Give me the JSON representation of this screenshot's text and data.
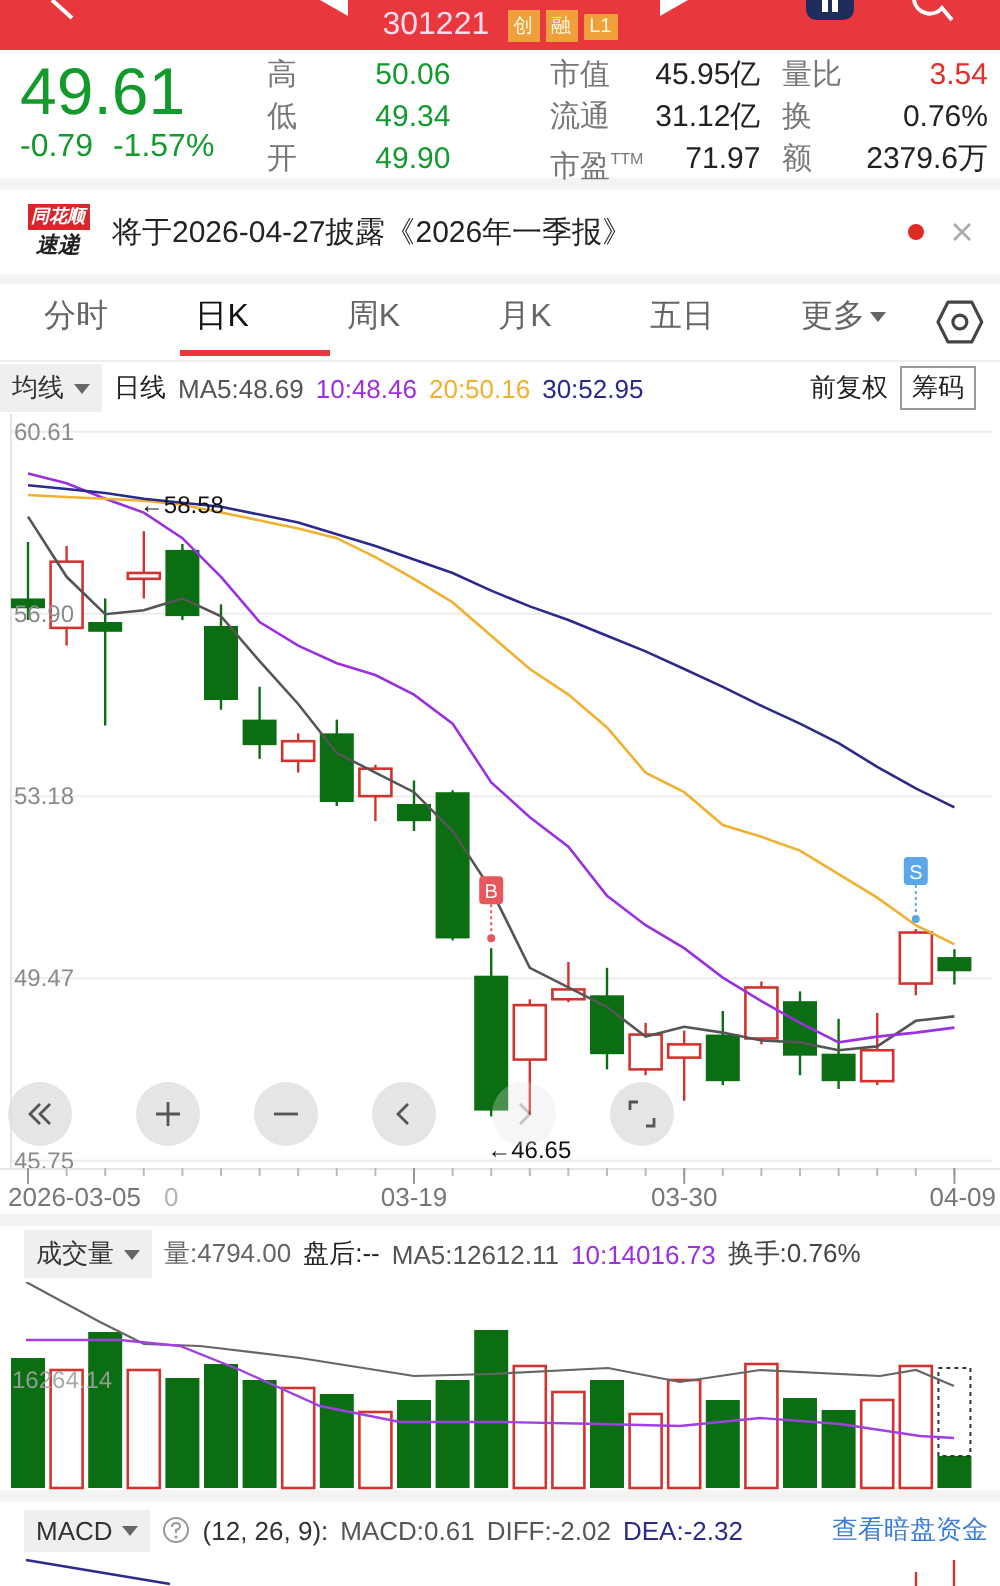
{
  "header": {
    "code": "301221",
    "badges": [
      "创",
      "融",
      "L1"
    ]
  },
  "quote": {
    "price": "49.61",
    "change": "-0.79",
    "change_pct": "-1.57%",
    "color": "#139a2c",
    "stat_columns": [
      [
        {
          "label": "高",
          "value": "50.06",
          "color": "#139a2c"
        },
        {
          "label": "低",
          "value": "49.34",
          "color": "#139a2c"
        },
        {
          "label": "开",
          "value": "49.90",
          "color": "#139a2c"
        }
      ],
      [
        {
          "label": "市值",
          "value": "45.95亿",
          "color": "#222222"
        },
        {
          "label": "流通",
          "value": "31.12亿",
          "color": "#222222"
        },
        {
          "label": "市盈$^{TTM}$",
          "value": "71.97",
          "color": "#222222"
        }
      ],
      [
        {
          "label": "量比",
          "value": "3.54",
          "color": "#e0302b"
        },
        {
          "label": "换",
          "value": "0.76%",
          "color": "#222222"
        },
        {
          "label": "额",
          "value": "2379.6万",
          "color": "#222222"
        }
      ]
    ]
  },
  "news": {
    "logo_top": "同花顺",
    "logo_bottom": "速递",
    "text": "将于2026-04-27披露《2026年一季报》",
    "unread": true
  },
  "kline": {
    "tabs": [
      {
        "label": "分时",
        "selected": false,
        "kind": "plain"
      },
      {
        "label": "日K",
        "selected": true,
        "kind": "plain"
      },
      {
        "label": "周K",
        "selected": false,
        "kind": "plain"
      },
      {
        "label": "月K",
        "selected": false,
        "kind": "plain"
      },
      {
        "label": "五日",
        "selected": false,
        "kind": "plain"
      },
      {
        "label": "更多",
        "selected": false,
        "kind": "dropdown"
      }
    ],
    "indicator": "均线",
    "period": "日线",
    "legend": [
      {
        "text": "MA5:48.69",
        "color": "#555555"
      },
      {
        "text": "10:48.46",
        "color": "#9b30e0"
      },
      {
        "text": "20:50.16",
        "color": "#f0b030"
      },
      {
        "text": "30:52.95",
        "color": "#2a2a8a"
      }
    ],
    "adjust": "前复权",
    "chips_button": "筹码",
    "candles": [
      {
        "rising": false
      },
      {
        "rising": true
      },
      {
        "rising": false
      },
      {
        "rising": true
      },
      {
        "rising": false
      },
      {
        "rising": false
      },
      {
        "rising": false
      },
      {
        "rising": true
      },
      {
        "rising": false
      },
      {
        "rising": true
      },
      {
        "rising": false
      },
      {
        "rising": false
      },
      {
        "rising": false
      },
      {
        "rising": true
      },
      {
        "rising": true
      },
      {
        "rising": false
      },
      {
        "rising": true
      },
      {
        "rising": true
      },
      {
        "rising": false
      },
      {
        "rising": true
      },
      {
        "rising": false
      },
      {
        "rising": false
      },
      {
        "rising": true
      },
      {
        "rising": true
      },
      {
        "rising": false
      }
    ],
    "extreme_labels": [
      "←58.58",
      "←46.65"
    ],
    "signals": [
      {
        "kind": "buy",
        "label": "B"
      },
      {
        "kind": "sell",
        "label": "S"
      }
    ],
    "date_labels": [
      "2026-03-05",
      "03-19",
      "03-30",
      "04-09"
    ],
    "xaxis_fragment": "0",
    "controls": [
      {
        "kind": "rewind",
        "disabled": false
      },
      {
        "kind": "zoom_in",
        "disabled": false
      },
      {
        "kind": "zoom_out",
        "disabled": false
      },
      {
        "kind": "prev",
        "disabled": false
      },
      {
        "kind": "next",
        "disabled": true
      },
      {
        "kind": "fullscreen",
        "disabled": false
      }
    ],
    "chart_data": {
      "type": "line",
      "grid": true,
      "ylim": [
        45.6,
        60.97
      ],
      "yticks": [
        {
          "value": 60.61,
          "label": "60.61"
        },
        {
          "value": 56.9,
          "label": "56.90"
        },
        {
          "value": 53.18,
          "label": "53.18"
        },
        {
          "value": 49.47,
          "label": "49.47"
        },
        {
          "value": 45.75,
          "label": "45.75"
        }
      ],
      "series": [
        {
          "color": "#555555",
          "values": [
            58.88,
            57.65,
            56.89,
            56.97,
            57.21,
            56.85,
            55.93,
            55.06,
            54.06,
            53.66,
            53.26,
            52.47,
            51.27,
            49.68,
            49.28,
            48.88,
            48.28,
            48.48,
            48.36,
            48.2,
            48.16,
            48.0,
            48.08,
            48.6,
            48.69
          ]
        },
        {
          "color": "#9b30e0",
          "values": [
            59.76,
            59.56,
            59.24,
            58.96,
            58.44,
            57.65,
            56.73,
            56.25,
            55.89,
            55.65,
            55.25,
            54.66,
            53.46,
            52.75,
            52.15,
            51.15,
            50.55,
            50.08,
            49.48,
            49.0,
            48.56,
            48.16,
            48.28,
            48.36,
            48.46
          ]
        },
        {
          "color": "#f0b030",
          "values": [
            59.32,
            59.28,
            59.24,
            59.2,
            59.12,
            58.96,
            58.8,
            58.64,
            58.44,
            58.05,
            57.61,
            57.13,
            56.45,
            55.77,
            55.25,
            54.58,
            53.66,
            53.26,
            52.59,
            52.35,
            52.07,
            51.59,
            51.11,
            50.55,
            50.16
          ]
        },
        {
          "color": "#2a2a8a",
          "values": [
            59.52,
            59.44,
            59.36,
            59.24,
            59.16,
            59.08,
            58.92,
            58.76,
            58.52,
            58.28,
            58.0,
            57.73,
            57.37,
            57.05,
            56.77,
            56.45,
            56.13,
            55.77,
            55.41,
            55.02,
            54.66,
            54.26,
            53.78,
            53.34,
            52.95
          ]
        }
      ]
    }
  },
  "volume": {
    "indicator": "成交量",
    "readings": [
      {
        "text": "量:4794.00",
        "color": "#666666"
      },
      {
        "text": "盘后:--",
        "color": "#222222"
      },
      {
        "text": "MA5:12612.11",
        "color": "#555555"
      },
      {
        "text": "10:14016.73",
        "color": "#9b30e0"
      },
      {
        "text": "换手:0.76%",
        "color": "#444444"
      }
    ],
    "axis_label": "16264.14"
  },
  "macd": {
    "indicator": "MACD",
    "params": "(12, 26, 9):",
    "readings": [
      {
        "text": "MACD:0.61",
        "color": "#555555"
      },
      {
        "text": "DIFF:-2.02",
        "color": "#555555"
      },
      {
        "text": "DEA:-2.32",
        "color": "#2a2a8a"
      }
    ],
    "link": "查看暗盘资金"
  }
}
